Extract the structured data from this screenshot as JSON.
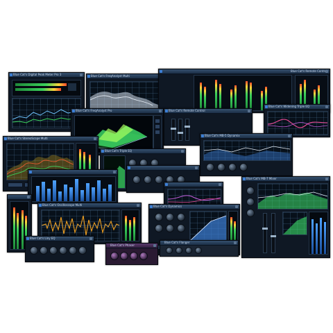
{
  "windows": {
    "digital_peak_meter": {
      "title": "Blue Cat's Digital Peak Meter Pro 3"
    },
    "freqanalyst": {
      "title": "Blue Cat's FreqAnalyst Multi"
    },
    "network": {
      "title": "Blue Cat's Remote Control"
    },
    "freqanalyst_pro": {
      "title": "Blue Cat's FreqAnalyst Pro"
    },
    "spectrum_top": {
      "title": "Blue Cat's Widening Triple EQ"
    },
    "stereoscope": {
      "title": "Blue Cat's StereoScope Multi"
    },
    "remote": {
      "title": "Blue Cat's Remote Control"
    },
    "mb5": {
      "title": "Blue Cat's MB-5 Dynamix"
    },
    "triple_eq": {
      "title": "Blue Cat's Triple EQ"
    },
    "oscilloscope": {
      "title": "Blue Cat's Oscilloscope Multi"
    },
    "dynamics": {
      "title": "Blue Cat's Dynamics"
    },
    "mb7": {
      "title": "Blue Cat's MB-7 Mixer"
    },
    "liny_eq": {
      "title": "Blue Cat's Liny EQ"
    },
    "phaser": {
      "title": "Blue Cat's Phaser"
    },
    "flanger": {
      "title": "Blue Cat's Flanger"
    }
  },
  "colors": {
    "accent": "#3c7fd6",
    "spectrum_green": "#3ee06a",
    "waveform_gold": "#f0a020",
    "plot_pink": "#e04890",
    "panel_bg": "#0f1824"
  }
}
